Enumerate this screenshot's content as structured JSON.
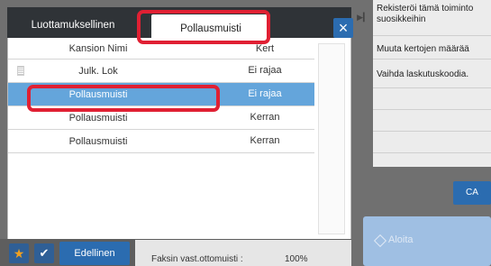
{
  "tabs": {
    "left_label": "Luottamuksellinen",
    "active_label": "Pollausmuisti"
  },
  "close_icon": "×",
  "columns": {
    "name": "Kansion Nimi",
    "count": "Kert"
  },
  "rows": [
    {
      "name": "Julk. Lok",
      "count": "Ei rajaa",
      "icon": "document-icon",
      "selected": false
    },
    {
      "name": "Pollausmuisti",
      "count": "Ei rajaa",
      "selected": true
    },
    {
      "name": "Pollausmuisti",
      "count": "Kerran",
      "selected": false
    },
    {
      "name": "Pollausmuisti",
      "count": "Kerran",
      "selected": false
    }
  ],
  "right_menu": {
    "items": [
      "Rekisteröi tämä toiminto suosikkeihin",
      "Muuta kertojen määrää",
      "Vaihda laskutuskoodia."
    ]
  },
  "buttons": {
    "ca": "CA",
    "start": "Aloita",
    "previous": "Edellinen"
  },
  "status": {
    "label": "Faksin vast.ottomuisti :",
    "value": "100%"
  },
  "colors": {
    "accent_blue": "#2b6cb0",
    "selection_blue": "#64a5db",
    "highlight_red": "#e02033"
  }
}
